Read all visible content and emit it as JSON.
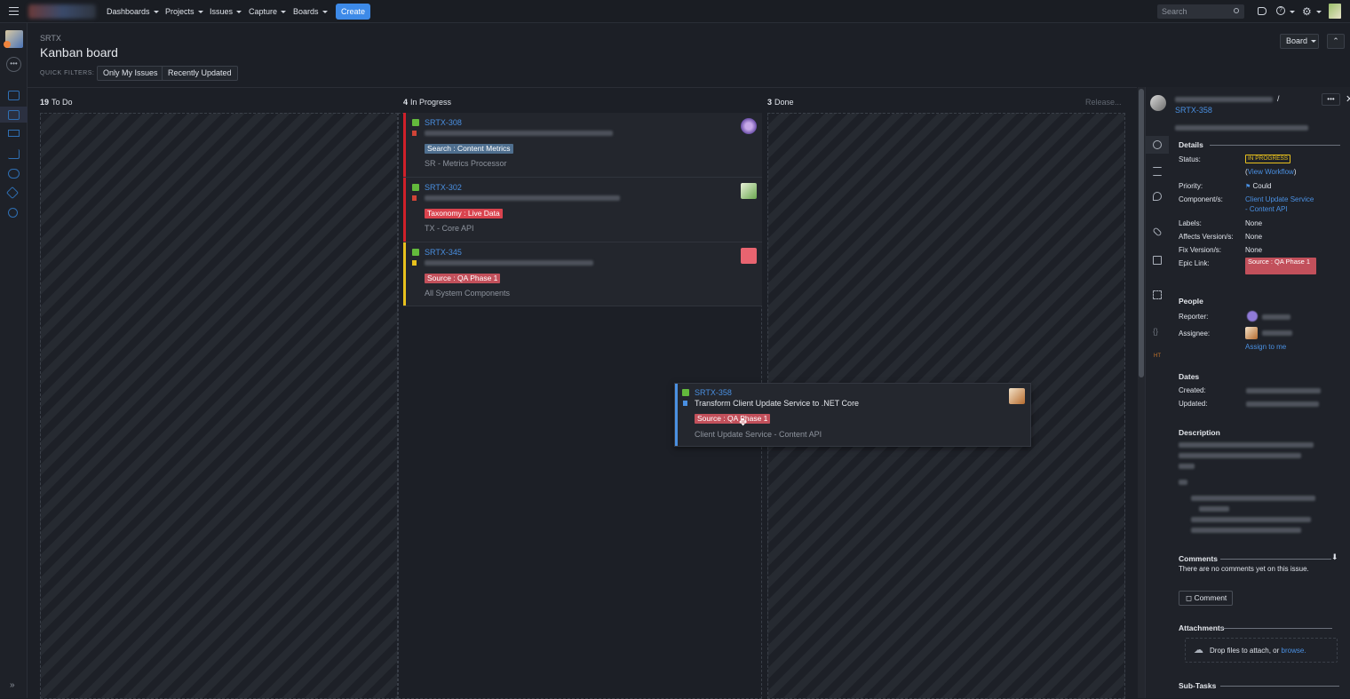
{
  "topnav": {
    "menu": [
      "Dashboards",
      "Projects",
      "Issues",
      "Capture",
      "Boards"
    ],
    "create_label": "Create",
    "search_placeholder": "Search"
  },
  "header": {
    "breadcrumb": "SRTX",
    "title": "Kanban board",
    "quick_filters_label": "QUICK FILTERS:",
    "quick_filters": [
      "Only My Issues",
      "Recently Updated"
    ],
    "board_menu_label": "Board"
  },
  "columns": [
    {
      "count": "19",
      "name": "To Do"
    },
    {
      "count": "4",
      "name": "In Progress"
    },
    {
      "count": "3",
      "name": "Done",
      "extra": "Release..."
    }
  ],
  "cards": [
    {
      "key": "SRTX-308",
      "tag": "Search : Content Metrics",
      "component": "SR - Metrics Processor",
      "tag_color": "#4f6f8f",
      "bar_color": "#d0202a"
    },
    {
      "key": "SRTX-302",
      "tag": "Taxonomy : Live Data",
      "component": "TX - Core API",
      "tag_color": "#d9434e",
      "bar_color": "#d0202a"
    },
    {
      "key": "SRTX-345",
      "tag": "Source : QA Phase 1",
      "component": "All System Components",
      "tag_color": "#c2505b",
      "bar_color": "#e8c11d"
    }
  ],
  "dragging_card": {
    "key": "SRTX-358",
    "summary": "Transform Client Update Service to .NET Core",
    "tag": "Source : QA Phase 1",
    "component": "Client Update Service - Content API"
  },
  "detail": {
    "issue_key": "SRTX-358",
    "sections": {
      "details": "Details",
      "people": "People",
      "dates": "Dates",
      "description": "Description",
      "comments": "Comments",
      "attachments": "Attachments",
      "subtasks": "Sub-Tasks"
    },
    "fields": {
      "status_label": "Status:",
      "status_value": "IN PROGRESS",
      "view_workflow": "View Workflow",
      "priority_label": "Priority:",
      "priority_value": "Could",
      "components_label": "Component/s:",
      "components_value_1": "Client Update Service",
      "components_value_2": "- Content API",
      "labels_label": "Labels:",
      "labels_value": "None",
      "affects_label": "Affects Version/s:",
      "affects_value": "None",
      "fix_label": "Fix Version/s:",
      "fix_value": "None",
      "epic_label": "Epic Link:",
      "epic_value": "Source : QA Phase 1",
      "reporter_label": "Reporter:",
      "assignee_label": "Assignee:",
      "assign_to_me": "Assign to me",
      "created_label": "Created:",
      "updated_label": "Updated:"
    },
    "comments_empty": "There are no comments yet on this issue.",
    "comment_button": "Comment",
    "drop_files": "Drop files to attach, or",
    "browse": "browse."
  }
}
